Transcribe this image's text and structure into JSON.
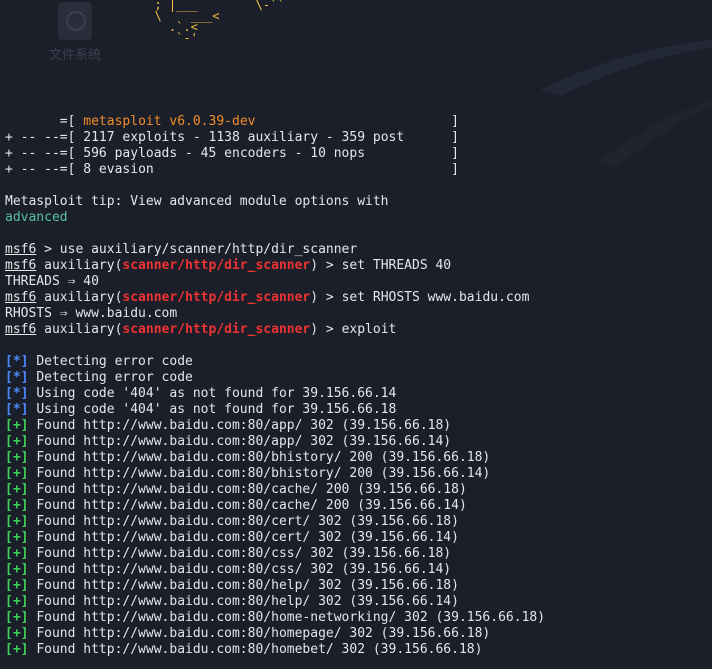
{
  "desktop": {
    "icon_label": "文件系统"
  },
  "ascii_art": "  ; |___        \\-``\n  \\    ___<\n    .`.<\n     `-'",
  "banner": [
    {
      "prefix": "       =[ ",
      "text": "metasploit v6.0.39-dev",
      "suffix": "                         ]",
      "color": "orange"
    },
    {
      "prefix": "+ -- --=[ ",
      "text": "2117 exploits - 1138 auxiliary - 359 post",
      "suffix": "      ]",
      "color": "plain"
    },
    {
      "prefix": "+ -- --=[ ",
      "text": "596 payloads - 45 encoders - 10 nops",
      "suffix": "           ]",
      "color": "plain"
    },
    {
      "prefix": "+ -- --=[ ",
      "text": "8 evasion",
      "suffix": "                                      ]",
      "color": "plain"
    }
  ],
  "tip": {
    "text": "Metasploit tip: View advanced module options with",
    "command": "advanced"
  },
  "prompts": {
    "msf": "msf6",
    "module_prefix": "auxiliary(",
    "module": "scanner/http/dir_scanner",
    "module_suffix": ")",
    "arrow": " > "
  },
  "commands": [
    {
      "with_module": false,
      "cmd": "use auxiliary/scanner/http/dir_scanner",
      "output": ""
    },
    {
      "with_module": true,
      "cmd": "set THREADS 40",
      "output": "THREADS ⇒ 40"
    },
    {
      "with_module": true,
      "cmd": "set RHOSTS www.baidu.com",
      "output": "RHOSTS ⇒ www.baidu.com"
    },
    {
      "with_module": true,
      "cmd": "exploit",
      "output": ""
    }
  ],
  "results": [
    {
      "tag": "[*]",
      "type": "info",
      "text": "Detecting error code"
    },
    {
      "tag": "[*]",
      "type": "info",
      "text": "Detecting error code"
    },
    {
      "tag": "[*]",
      "type": "info",
      "text": "Using code '404' as not found for 39.156.66.14"
    },
    {
      "tag": "[*]",
      "type": "info",
      "text": "Using code '404' as not found for 39.156.66.18"
    },
    {
      "tag": "[+]",
      "type": "found",
      "text": "Found http://www.baidu.com:80/app/ 302 (39.156.66.18)"
    },
    {
      "tag": "[+]",
      "type": "found",
      "text": "Found http://www.baidu.com:80/app/ 302 (39.156.66.14)"
    },
    {
      "tag": "[+]",
      "type": "found",
      "text": "Found http://www.baidu.com:80/bhistory/ 200 (39.156.66.18)"
    },
    {
      "tag": "[+]",
      "type": "found",
      "text": "Found http://www.baidu.com:80/bhistory/ 200 (39.156.66.14)"
    },
    {
      "tag": "[+]",
      "type": "found",
      "text": "Found http://www.baidu.com:80/cache/ 200 (39.156.66.18)"
    },
    {
      "tag": "[+]",
      "type": "found",
      "text": "Found http://www.baidu.com:80/cache/ 200 (39.156.66.14)"
    },
    {
      "tag": "[+]",
      "type": "found",
      "text": "Found http://www.baidu.com:80/cert/ 302 (39.156.66.18)"
    },
    {
      "tag": "[+]",
      "type": "found",
      "text": "Found http://www.baidu.com:80/cert/ 302 (39.156.66.14)"
    },
    {
      "tag": "[+]",
      "type": "found",
      "text": "Found http://www.baidu.com:80/css/ 302 (39.156.66.18)"
    },
    {
      "tag": "[+]",
      "type": "found",
      "text": "Found http://www.baidu.com:80/css/ 302 (39.156.66.14)"
    },
    {
      "tag": "[+]",
      "type": "found",
      "text": "Found http://www.baidu.com:80/help/ 302 (39.156.66.18)"
    },
    {
      "tag": "[+]",
      "type": "found",
      "text": "Found http://www.baidu.com:80/help/ 302 (39.156.66.14)"
    },
    {
      "tag": "[+]",
      "type": "found",
      "text": "Found http://www.baidu.com:80/home-networking/ 302 (39.156.66.18)"
    },
    {
      "tag": "[+]",
      "type": "found",
      "text": "Found http://www.baidu.com:80/homepage/ 302 (39.156.66.18)"
    },
    {
      "tag": "[+]",
      "type": "found",
      "text": "Found http://www.baidu.com:80/homebet/ 302 (39.156.66.18)"
    }
  ],
  "colors": {
    "background": "#1b1f2a",
    "banner_accent": "#f08c28",
    "tip_command": "#56c29c",
    "module": "#ee3333",
    "info_tag": "#4a8cff",
    "found_tag": "#3fcf5a"
  }
}
